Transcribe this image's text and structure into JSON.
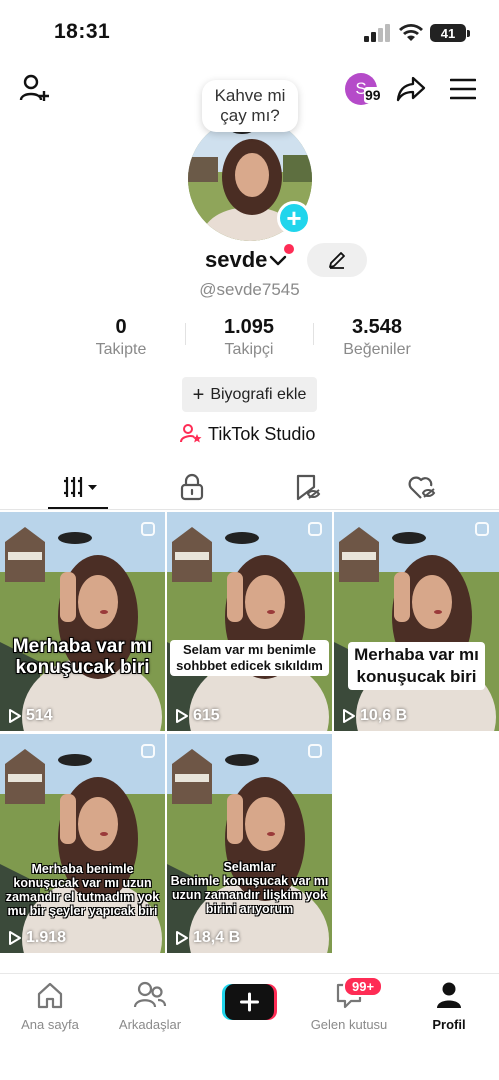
{
  "status": {
    "time": "18:31",
    "battery": "41"
  },
  "header": {
    "account_initial": "S",
    "account_badge": "99"
  },
  "profile": {
    "bubble_text_1": "Kahve mi",
    "bubble_text_2": "çay mı?",
    "name": "sevde",
    "handle": "@sevde7545",
    "stats": [
      {
        "value": "0",
        "label": "Takipte"
      },
      {
        "value": "1.095",
        "label": "Takipçi"
      },
      {
        "value": "3.548",
        "label": "Beğeniler"
      }
    ],
    "bio_button": "Biyografi ekle",
    "studio_label": "TikTok Studio"
  },
  "videos": [
    {
      "caption_lines": [
        "Merhaba var mı",
        "konuşucak biri"
      ],
      "views": "514"
    },
    {
      "caption_lines": [
        "Selam var mı benimle",
        "sohbbet edicek sıkıldım"
      ],
      "views": "615"
    },
    {
      "caption_lines": [
        "Merhaba var mı",
        "konuşucak biri"
      ],
      "views": "10,6 B"
    },
    {
      "caption_lines": [
        "Merhaba benimle",
        "konuşucak var mı uzun",
        "zamandır el tutmadım yok",
        "mu bir şeyler yapıcak biri"
      ],
      "views": "1.918"
    },
    {
      "caption_lines": [
        "Selamlar",
        "Benimle konuşucak var mı",
        "uzun zamandır ilişkim yok",
        "birini arıyorum"
      ],
      "views": "18,4 B"
    }
  ],
  "nav": {
    "home": "Ana sayfa",
    "friends": "Arkadaşlar",
    "inbox": "Gelen kutusu",
    "inbox_badge": "99+",
    "profile": "Profil"
  },
  "colors": {
    "accent_red": "#fe2c55",
    "accent_cyan": "#20d5ec",
    "avatar_purple": "#b54bc9"
  }
}
